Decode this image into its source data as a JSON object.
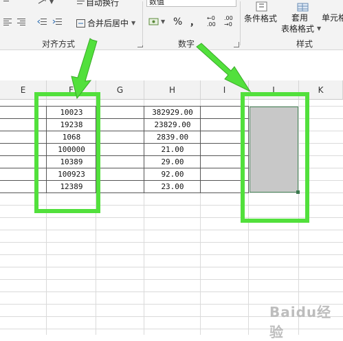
{
  "ribbon": {
    "wrap_text_label": "自动换行",
    "merge_center_label": "合并后居中",
    "number_format_value": "数值",
    "percent_symbol": "%",
    "comma_symbol": "，",
    "increase_decimal_label": "←0 .00",
    "decrease_decimal_label": ".00 →0",
    "conditional_format_label": "条件格式",
    "table_format_label_1": "套用",
    "table_format_label_2": "表格格式",
    "cell_styles_label": "单元格",
    "groups": {
      "alignment": "对齐方式",
      "number": "数字",
      "styles": "样式"
    }
  },
  "columns": [
    "E",
    "F",
    "G",
    "H",
    "I",
    "J",
    "K"
  ],
  "col_f_values": [
    "10023",
    "19238",
    "1068",
    "100000",
    "10389",
    "100923",
    "12389"
  ],
  "col_h_values": [
    "382929.00",
    "23829.00",
    "2839.00",
    "21.00",
    "29.00",
    "92.00",
    "23.00"
  ],
  "watermark": "Baidu经验",
  "colors": {
    "highlight": "#52e03c",
    "selection_fill": "#c8c8c8",
    "selection_border": "#4a8a5c"
  }
}
